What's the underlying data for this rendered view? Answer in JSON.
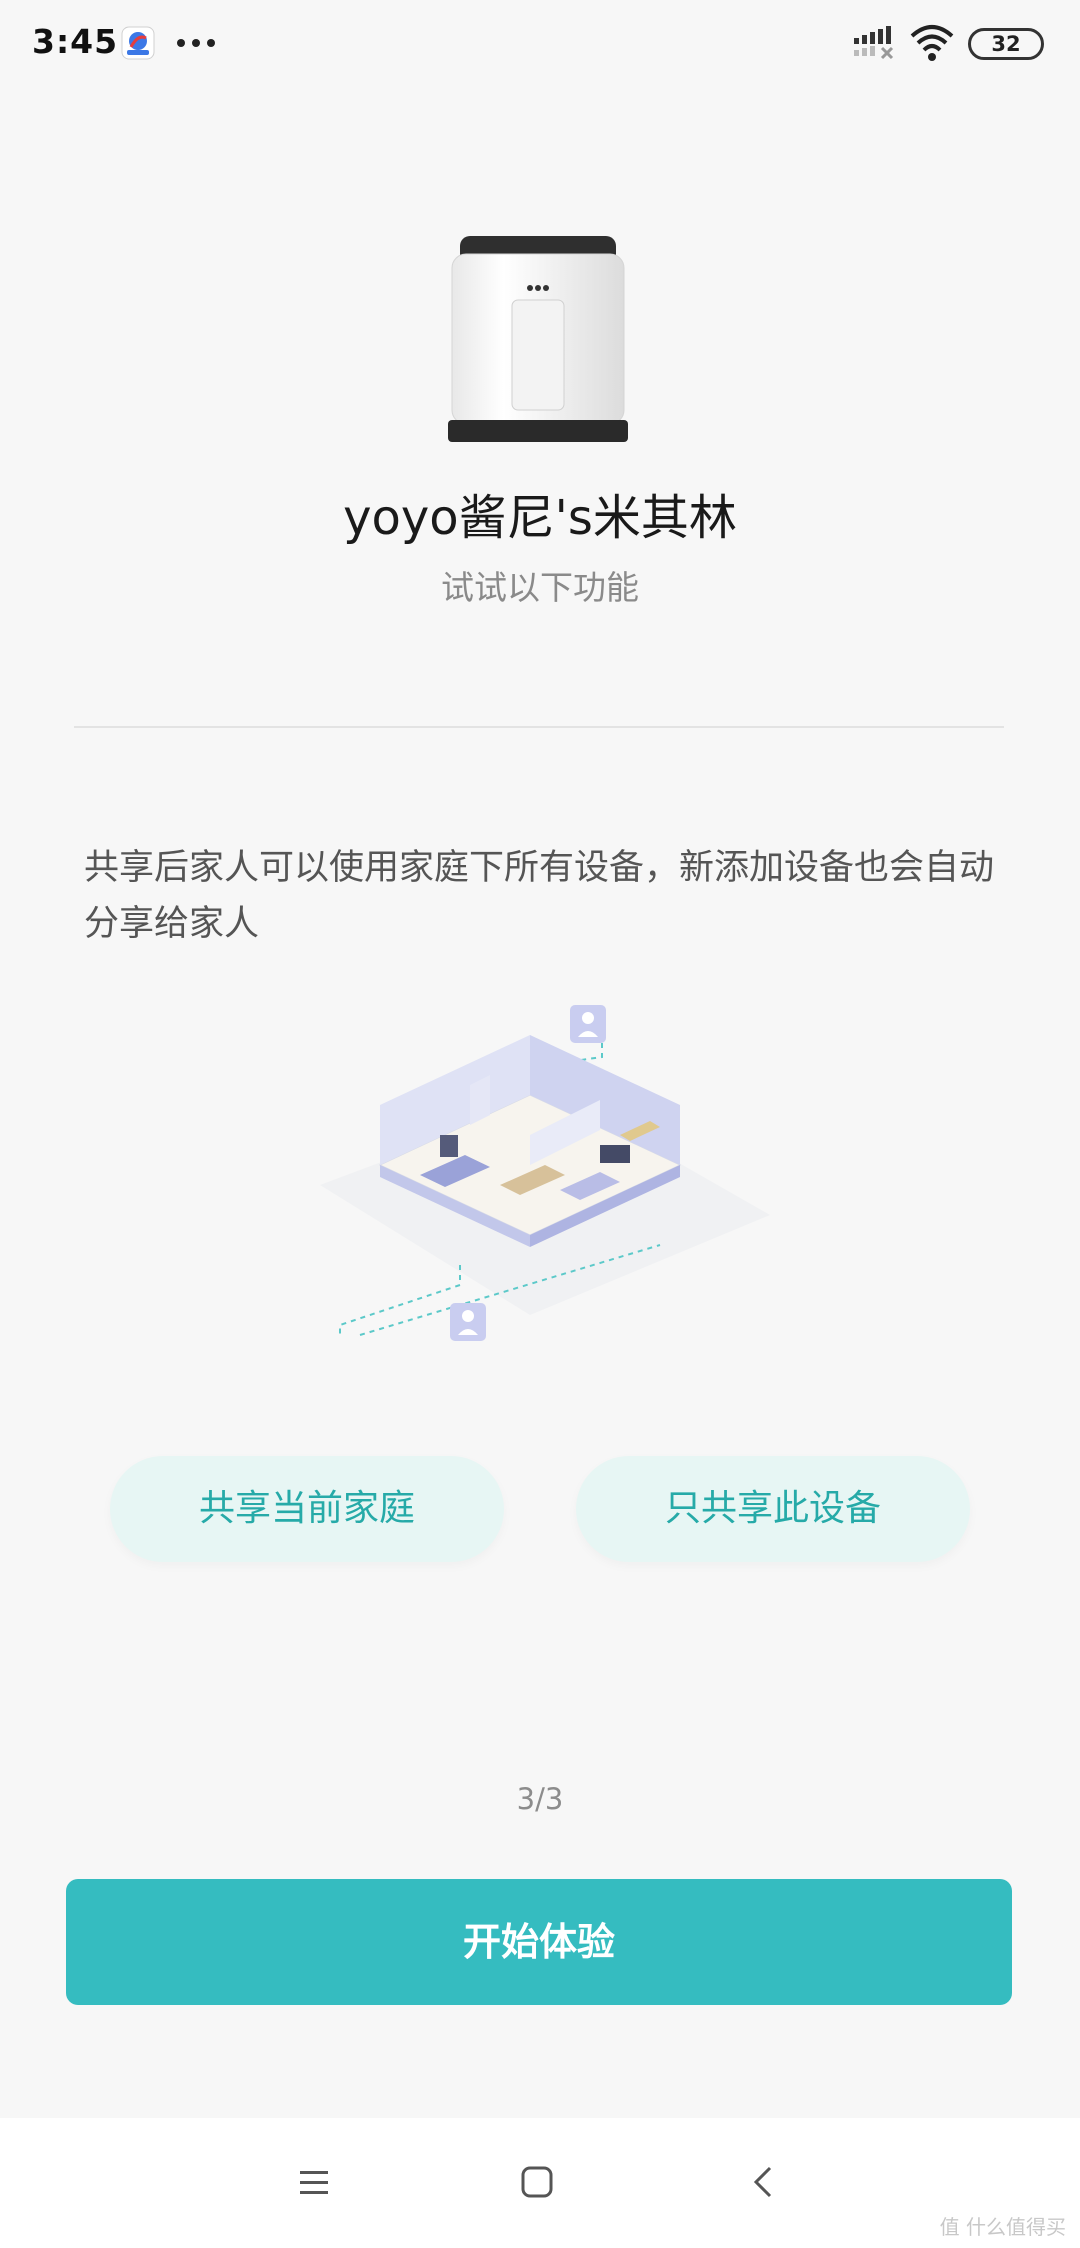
{
  "status_bar": {
    "time": "3:45",
    "battery": "32"
  },
  "device": {
    "name": "yoyo酱尼's米其林",
    "subtitle": "试试以下功能"
  },
  "description": "共享后家人可以使用家庭下所有设备，新添加设备也会自动分享给家人",
  "options": {
    "share_home": "共享当前家庭",
    "share_device": "只共享此设备"
  },
  "page_indicator": "3/3",
  "start_button": "开始体验",
  "watermark": "值 什么值得买",
  "colors": {
    "accent": "#35bcc0",
    "option_bg": "#e7f6f4",
    "option_text": "#26aaa8",
    "background": "#f7f7f7"
  },
  "icons": {
    "app": "browser-app-icon",
    "more": "more-dots-icon",
    "signal": "cell-signal-icon",
    "wifi": "wifi-icon",
    "nav_menu": "menu-icon",
    "nav_home": "home-square-icon",
    "nav_back": "back-chevron-icon"
  }
}
